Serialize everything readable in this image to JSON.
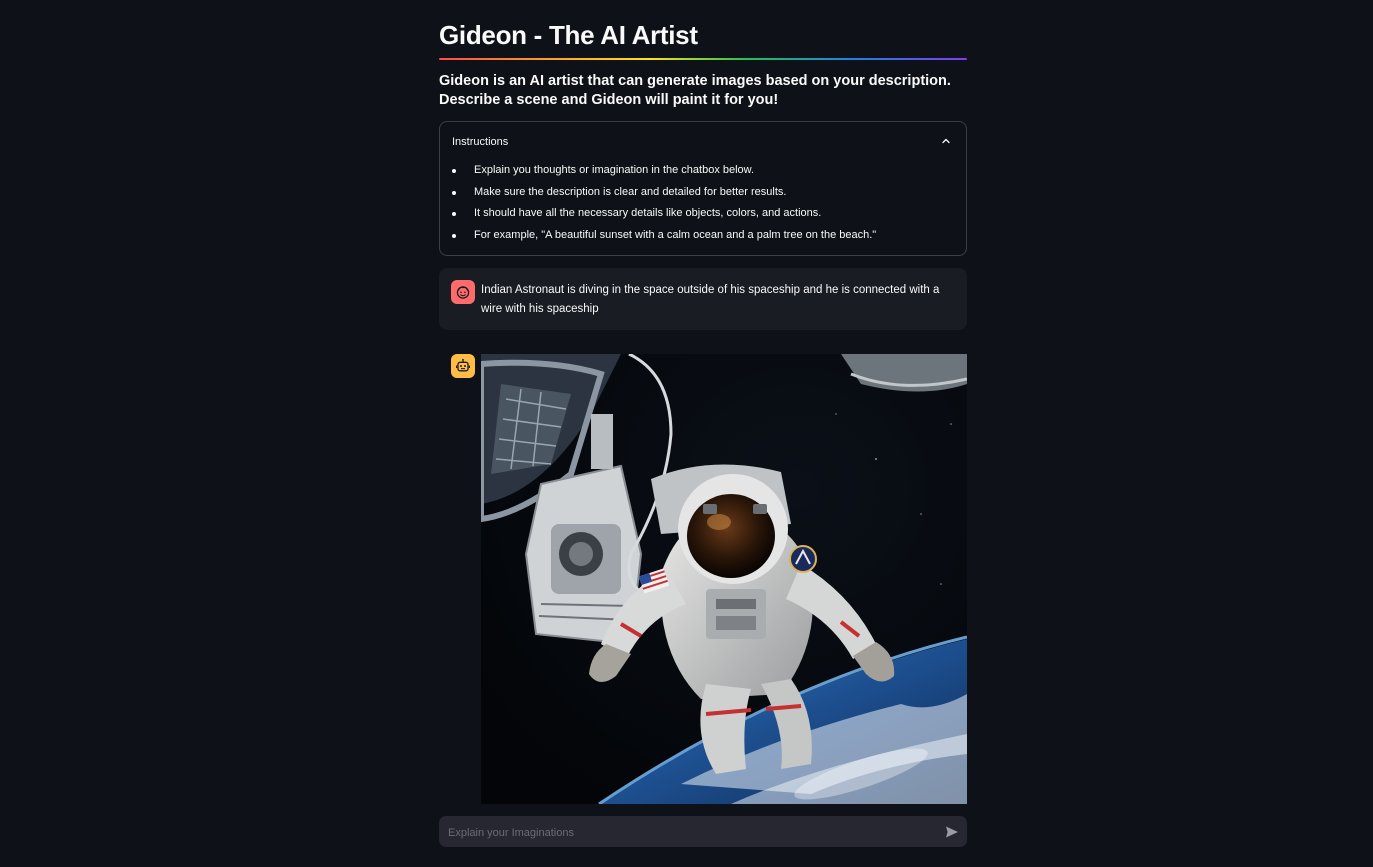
{
  "header": {
    "title": "Gideon - The AI Artist",
    "subtitle_line1": "Gideon is an AI artist that can generate images based on your description.",
    "subtitle_line2": "Describe a scene and Gideon will paint it for you!"
  },
  "instructions": {
    "title": "Instructions",
    "expanded": true,
    "items": [
      "Explain you thoughts or imagination in the chatbox below.",
      "Make sure the description is clear and detailed for better results.",
      "It should have all the necessary details like objects, colors, and actions.",
      "For example, \"A beautiful sunset with a calm ocean and a palm tree on the beach.\""
    ]
  },
  "chat": {
    "messages": [
      {
        "role": "user",
        "avatar_icon": "user-face-icon",
        "text": "Indian Astronaut is diving in the space outside of his spaceship and he is connected with a wire with his spaceship"
      },
      {
        "role": "assistant",
        "avatar_icon": "robot-icon",
        "image_description": "astronaut floating in space tethered to spaceship above earth"
      }
    ]
  },
  "chat_input": {
    "placeholder": "Explain your Imaginations",
    "value": ""
  },
  "colors": {
    "background": "#0e1117",
    "user_avatar": "#ff6b6b",
    "assistant_avatar": "#ffbd45",
    "input_background": "#262730"
  }
}
